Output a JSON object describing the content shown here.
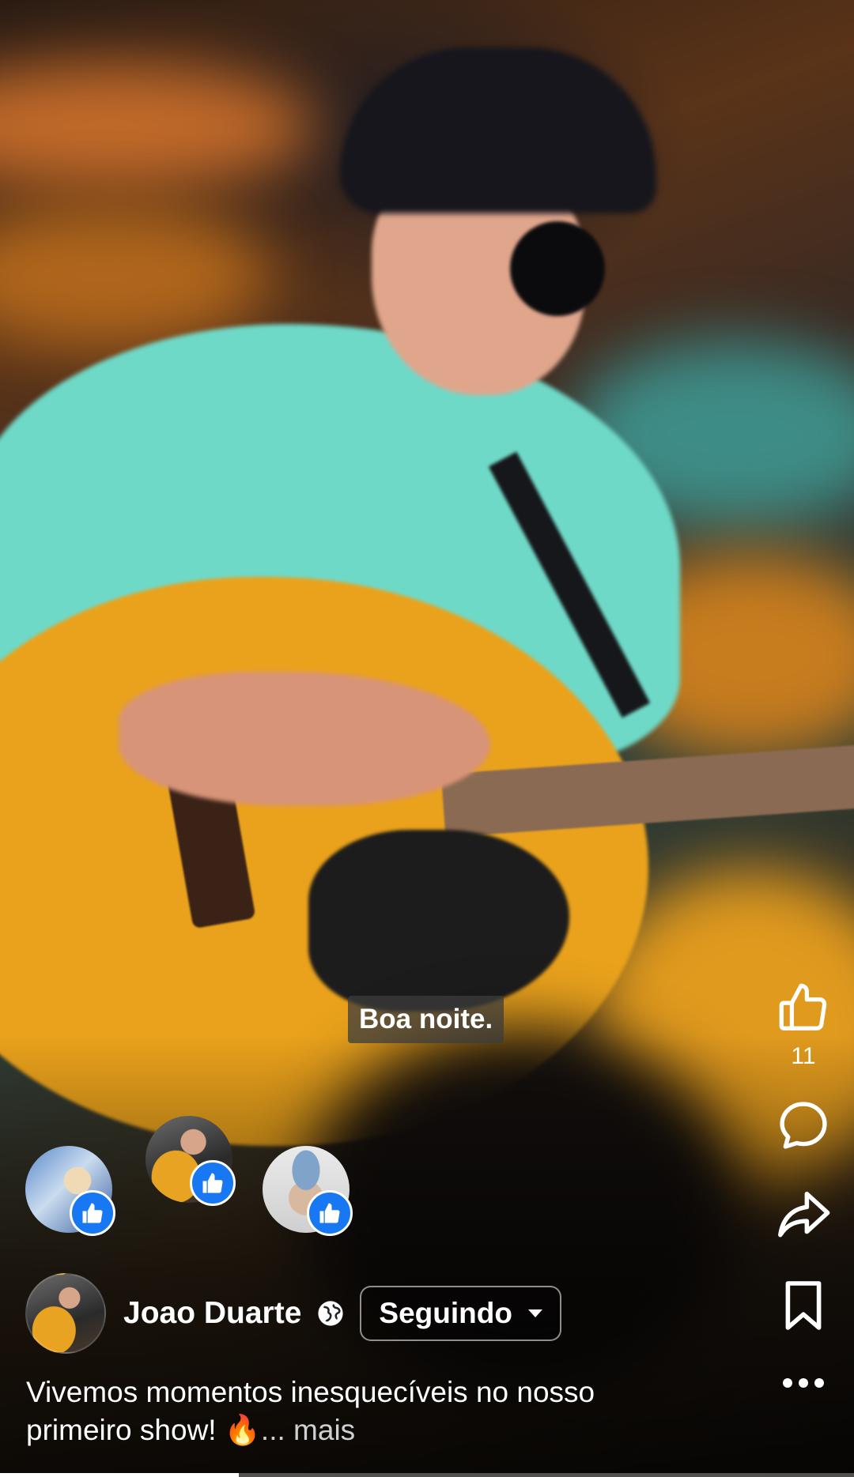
{
  "video": {
    "subtitle": "Boa noite.",
    "progress_fraction": 0.28
  },
  "actions": {
    "like_count": "11",
    "like_icon": "thumbs-up-icon",
    "comment_icon": "comment-icon",
    "share_icon": "share-icon",
    "save_icon": "bookmark-icon",
    "more_icon": "more-icon"
  },
  "reactions": {
    "reactors": [
      {
        "avatar": "reactor-avatar-1",
        "reaction": "like"
      },
      {
        "avatar": "reactor-avatar-2",
        "reaction": "like"
      },
      {
        "avatar": "reactor-avatar-3",
        "reaction": "like"
      }
    ]
  },
  "post": {
    "author": "Joao Duarte",
    "privacy_icon": "globe-icon",
    "follow_label": "Seguindo",
    "caption": "Vivemos momentos inesquecíveis no nosso primeiro show! 🔥",
    "more_label": "... mais"
  },
  "colors": {
    "like_blue": "#1877f2",
    "white": "#ffffff"
  }
}
